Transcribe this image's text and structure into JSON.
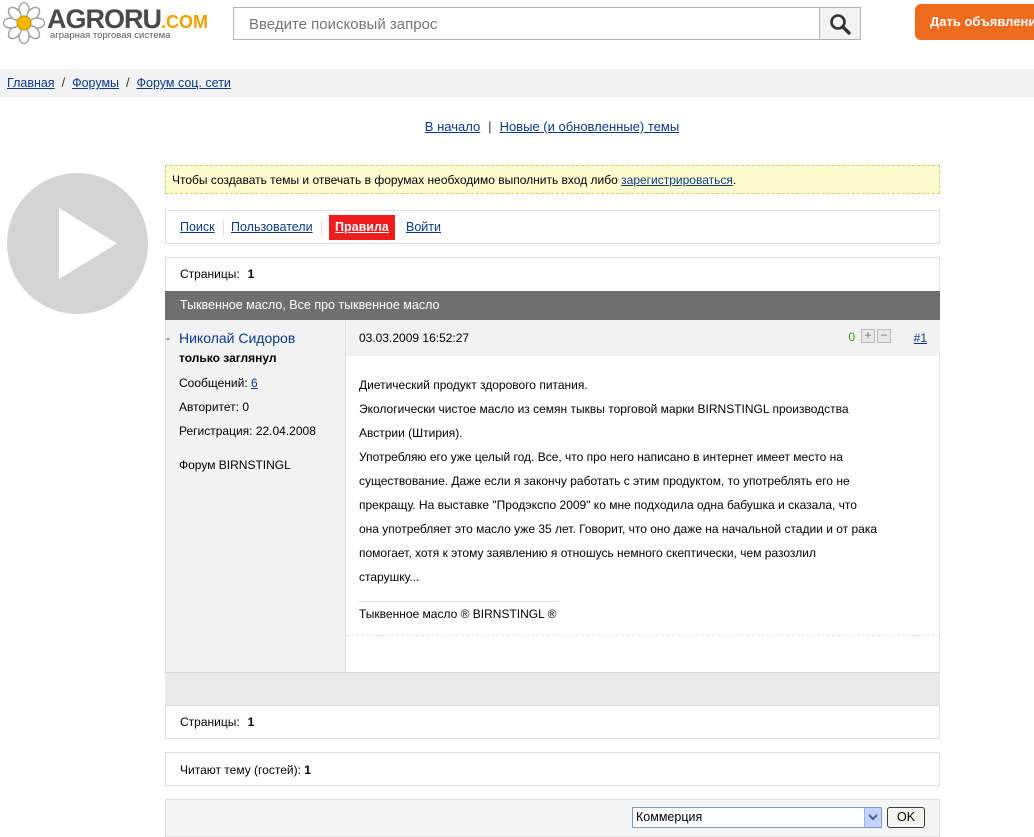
{
  "header": {
    "logo_main": "AGRORU",
    "logo_domain": ".COM",
    "logo_tagline": "аграрная торговая система",
    "search_placeholder": "Введите поисковый запрос",
    "post_ad_button": "Дать объявление"
  },
  "breadcrumb": [
    {
      "label": "Главная"
    },
    {
      "label": "Форумы"
    },
    {
      "label": "Форум соц. сети"
    }
  ],
  "top_nav": {
    "home": "В начало",
    "new_topics": "Новые (и обновленные) темы"
  },
  "notice": {
    "text": "Чтобы создавать темы и отвечать в форумах необходимо выполнить вход либо ",
    "link": "зарегистрироваться",
    "end": "."
  },
  "toolbar": {
    "search": "Поиск",
    "users": "Пользователи",
    "rules": "Правила",
    "login": "Войти"
  },
  "pages": {
    "label": "Страницы:",
    "current": "1"
  },
  "topic_title": "Тыквенное масло, Все про тыквенное масло",
  "post": {
    "author": {
      "name": "Николай Сидоров",
      "status": "только заглянул",
      "messages_label": "Сообщений:",
      "messages": "6",
      "authority": "Авторитет: 0",
      "registered": "Регистрация: 22.04.2008",
      "forum": "Форум BIRNSTINGL"
    },
    "date": "03.03.2009 16:52:27",
    "rating": "0",
    "number": "#1",
    "lines": [
      "Диетический продукт здорового питания.",
      "Экологически чистое масло из семян тыквы торговой марки BIRNSTINGL производства",
      "Австрии (Штирия).",
      "Употребляю его уже целый год. Все, что про него написано в интернет имеет место на",
      "существование. Даже если я закончу работать с этим продуктом, то употреблять его не",
      "прекращу. На выставке \"Продэкспо 2009\" ко мне подходила одна бабушка и сказала, что",
      "она употребляет это масло уже 35 лет. Говорит, что оно даже на начальной стадии и от рака",
      "помогает, хотя к этому заявлению я отношусь немного скептически, чем разозлил",
      "старушку..."
    ],
    "signature": "Тыквенное масло ® BIRNSTINGL ®"
  },
  "readers": {
    "label": "Читают тему (гостей): ",
    "count": "1"
  },
  "jump": {
    "selected": "Коммерция",
    "ok": "OK"
  },
  "colors": {
    "accent": "#ee6a1d",
    "rules": "#ee1c1c",
    "link": "#0a3a87"
  }
}
